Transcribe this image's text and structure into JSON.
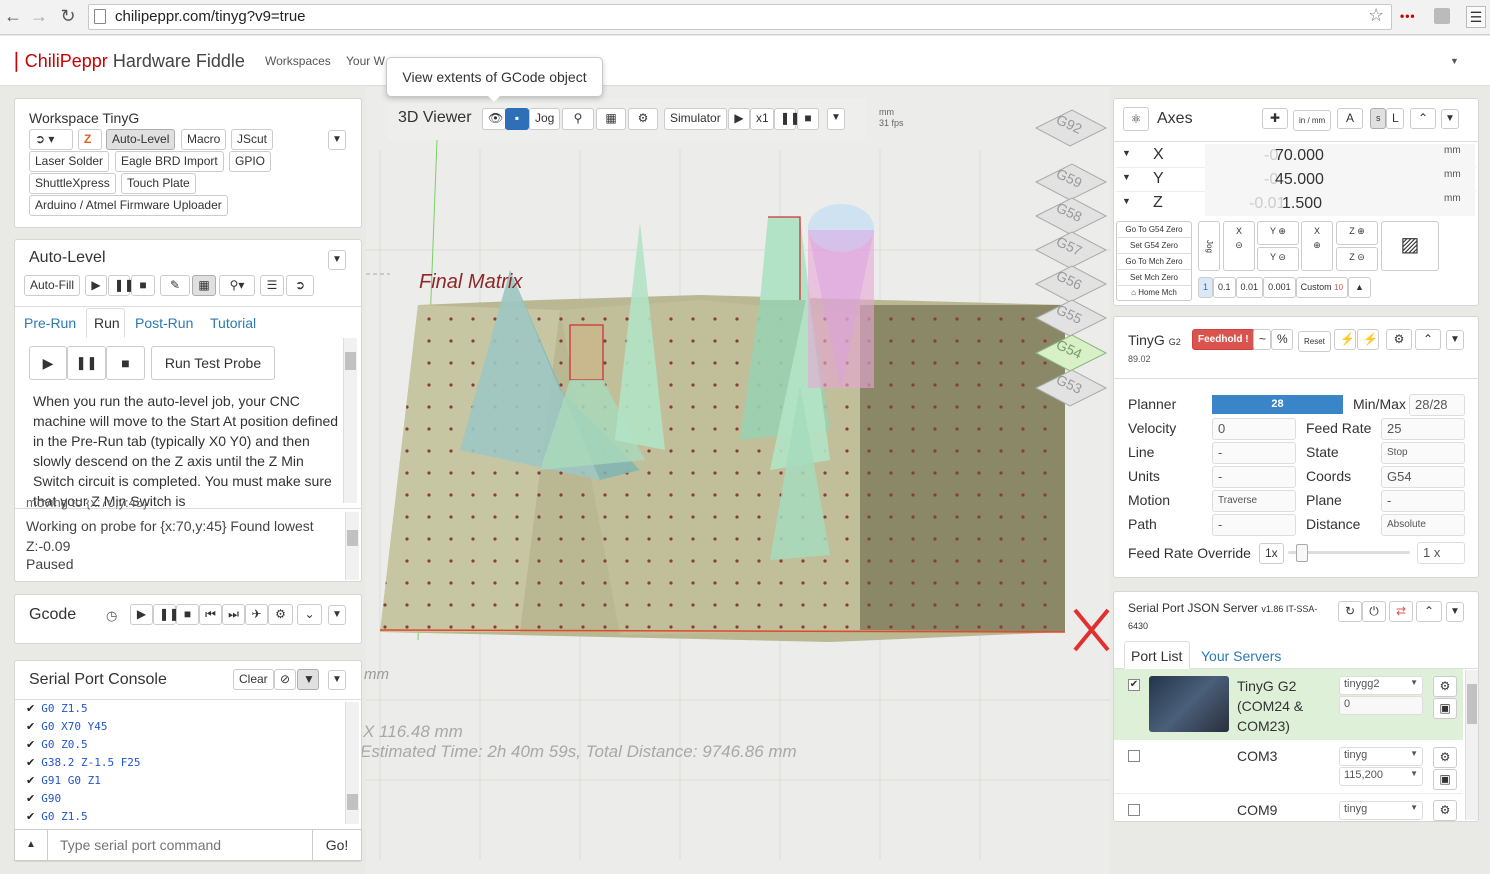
{
  "browser": {
    "url": "chilipeppr.com/tinyg?v9=true"
  },
  "app": {
    "brand_a": "ChiliPeppr",
    "brand_b": "Hardware Fiddle",
    "nav": [
      "Workspaces",
      "Your W"
    ]
  },
  "tooltip": "View extents of GCode object",
  "workspace": {
    "title": "Workspace TinyG",
    "buttons_r1": [
      "Auto-Level",
      "Macro",
      "JScut"
    ],
    "buttons_r2": [
      "Laser Solder",
      "Eagle BRD Import",
      "GPIO"
    ],
    "buttons_r3": [
      "ShuttleXpress",
      "Touch Plate"
    ],
    "buttons_r4": [
      "Arduino / Atmel Firmware Uploader"
    ]
  },
  "autolevel": {
    "title": "Auto-Level",
    "autofill": "Auto-Fill",
    "tabs": [
      "Pre-Run",
      "Run",
      "Post-Run",
      "Tutorial"
    ],
    "run_test": "Run Test Probe",
    "desc": "When you run the auto-level job, your CNC machine will move to the Start At position defined in the Pre-Run tab (typically X0 Y0) and then slowly descend on the Z axis until the Z Min Switch circuit is completed. You must make sure that your Z Min Switch is",
    "log_top": "moving to {x:70,y:45}",
    "log": "Working on probe for {x:70,y:45} Found lowest Z:-0.09",
    "status": "Paused"
  },
  "gcode": {
    "title": "Gcode"
  },
  "serial": {
    "title": "Serial Port Console",
    "clear": "Clear",
    "lines": [
      "G0 Z1.5",
      "G0 X70 Y45",
      "G0 Z0.5",
      "G38.2 Z-1.5 F25",
      "G91 G0 Z1",
      "G90",
      "G0 Z1.5"
    ],
    "placeholder": "Type serial port command",
    "go": "Go!"
  },
  "viewer": {
    "title": "3D Viewer",
    "jog": "Jog",
    "simulator": "Simulator",
    "speed": "x1",
    "units": "mm",
    "fps": "31 fps",
    "overlay": "Final Matrix",
    "mm_label": "mm",
    "extent": "X 116.48 mm",
    "estimate": "Estimated Time: 2h 40m 59s, Total Distance: 9746.86 mm",
    "cs": [
      "G92",
      "G59",
      "G58",
      "G57",
      "G56",
      "G55",
      "G54",
      "G53"
    ]
  },
  "axes": {
    "title": "Axes",
    "inmm": "in / mm",
    "rows": [
      {
        "axis": "X",
        "value": "70.000",
        "ghost": "-0",
        "unit": "mm"
      },
      {
        "axis": "Y",
        "value": "45.000",
        "ghost": "-0",
        "unit": "mm"
      },
      {
        "axis": "Z",
        "value": "1.500",
        "ghost": "-0.01",
        "unit": "mm"
      }
    ],
    "zero_buttons": [
      "Go To G54 Zero",
      "Set G54 Zero",
      "Go To Mch Zero",
      "Set Mch Zero",
      "Home Mch"
    ],
    "jog_label": "Jog",
    "steps": [
      "1",
      "0.1",
      "0.01",
      "0.001",
      "Custom"
    ],
    "custom_val": "10"
  },
  "tinyg": {
    "title": "TinyG",
    "sub": "G2",
    "build": "89.02",
    "feedhold": "Feedhold !",
    "reset": "Reset",
    "planner": "28",
    "minmax": "28/28",
    "velocity": "0",
    "feedrate": "25",
    "line": "-",
    "state": "Stop",
    "units": "-",
    "coords": "G54",
    "motion": "Traverse",
    "plane": "-",
    "path": "-",
    "distance": "Absolute",
    "override_btn": "1x",
    "override_val": "1 x",
    "labels": {
      "planner": "Planner",
      "minmax": "Min/Max",
      "velocity": "Velocity",
      "feedrate": "Feed Rate",
      "line": "Line",
      "state": "State",
      "units": "Units",
      "coords": "Coords",
      "motion": "Motion",
      "plane": "Plane",
      "path": "Path",
      "distance": "Distance",
      "override": "Feed Rate Override"
    }
  },
  "spjs": {
    "title": "Serial Port JSON Server",
    "ver": "v1.86 IT-SSA-6430",
    "tabs": [
      "Port List",
      "Your Servers"
    ],
    "ports": [
      {
        "name": "TinyG G2 (COM24 & COM23)",
        "driver": "tinygg2",
        "baud": "0"
      },
      {
        "name": "COM3",
        "driver": "tinyg",
        "baud": "115,200"
      },
      {
        "name": "COM9",
        "driver": "tinyg"
      }
    ]
  },
  "colors": {
    "accent": "#337ab7",
    "feedhold": "#d9534f",
    "port_sel": "#dff0d8"
  }
}
